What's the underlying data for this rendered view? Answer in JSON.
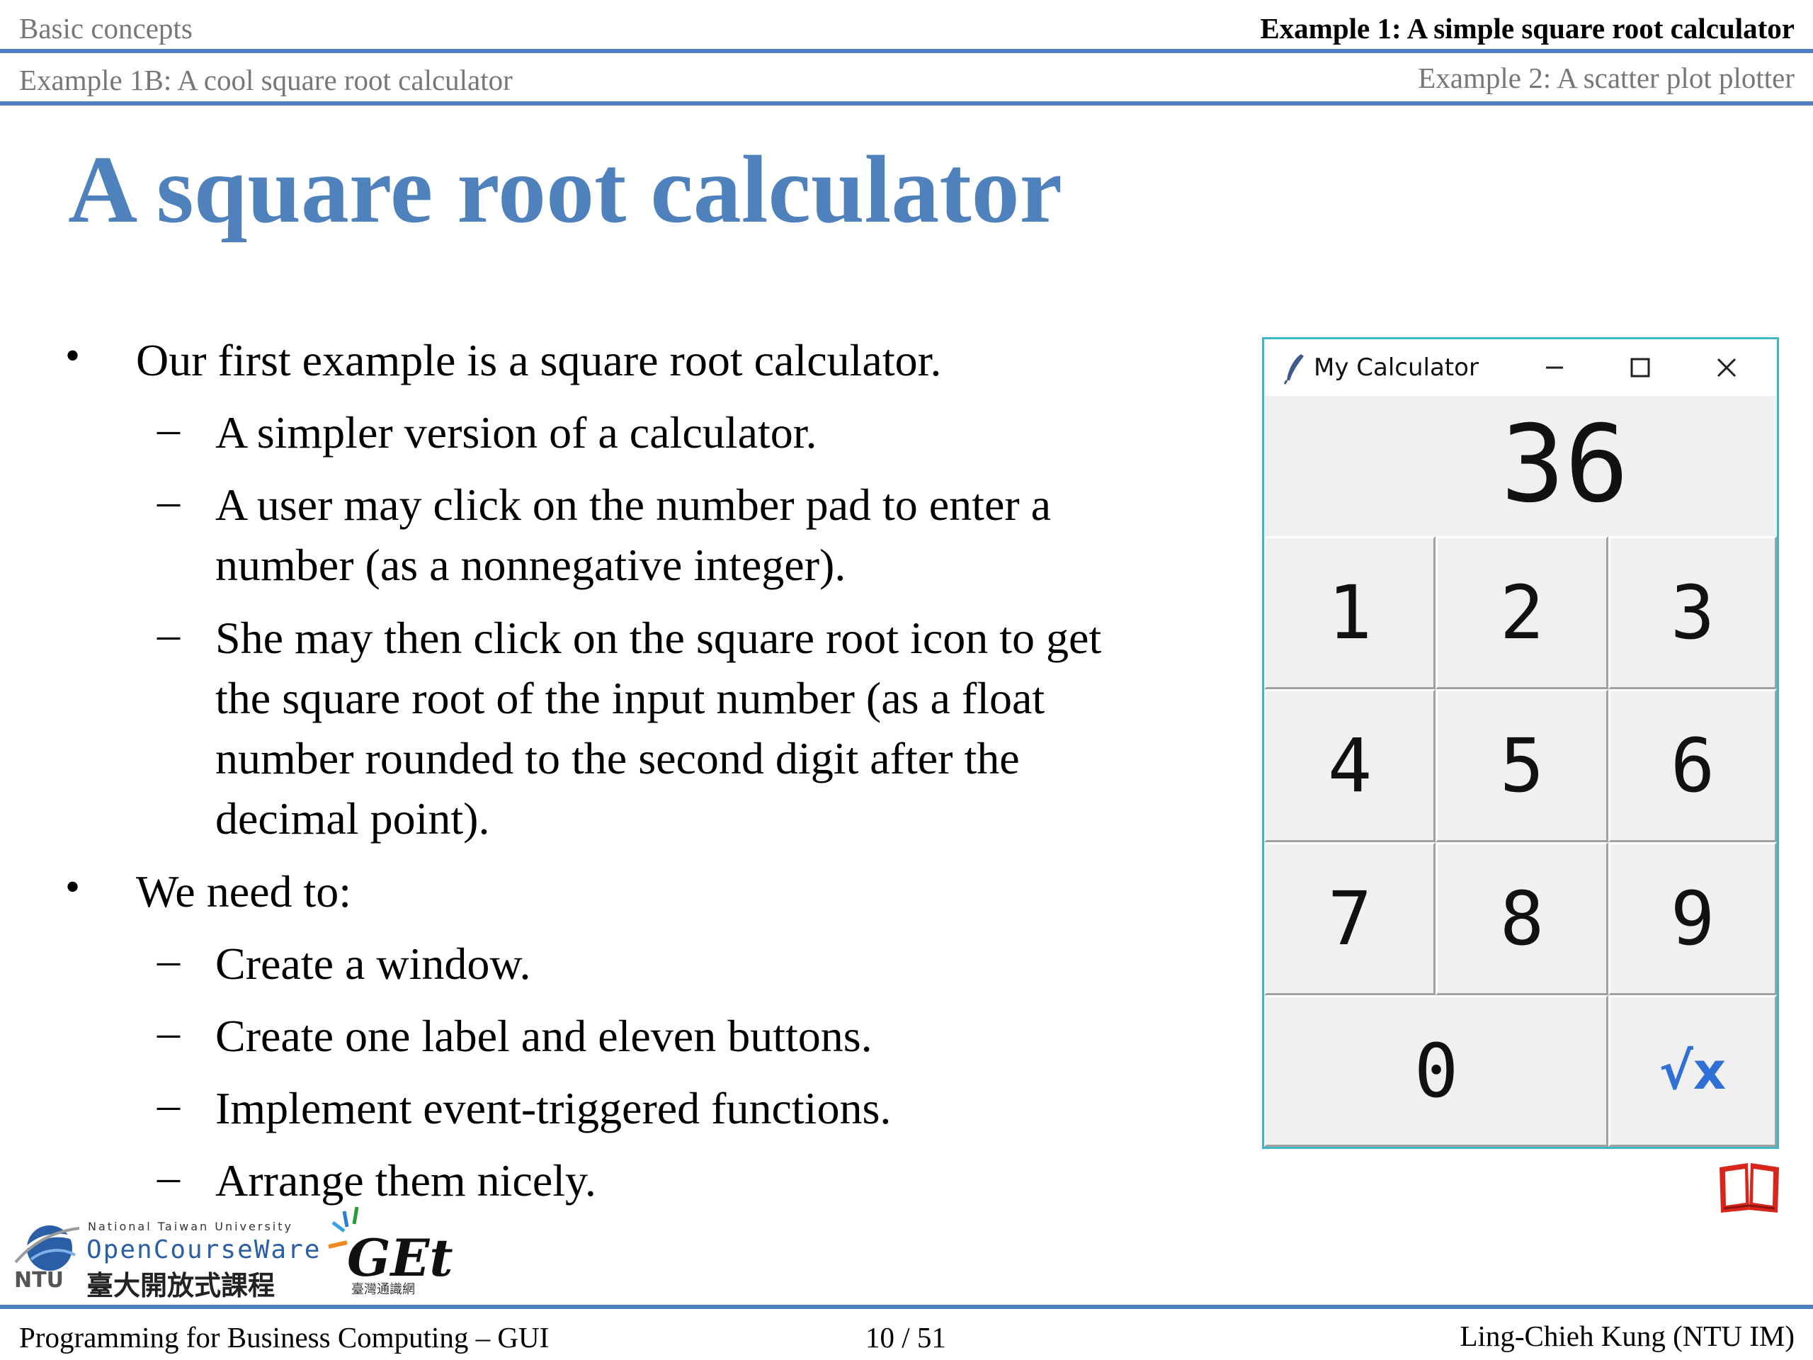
{
  "header": {
    "section_left": "Basic concepts",
    "section_right": "Example 1: A simple square root calculator",
    "sub_left": "Example 1B: A cool square root calculator",
    "sub_right": "Example 2: A scatter plot plotter"
  },
  "slide": {
    "title": "A square root calculator",
    "bullets": [
      "Our first example is a square root calculator.",
      "A simpler version of a calculator.",
      "A user may click on the number pad to enter a",
      "number (as a nonnegative integer).",
      "She may then click on the square root icon to get",
      "the square root of the input number (as a float",
      "number rounded to the second digit after the",
      "decimal point).",
      "We need to:",
      "Create a window.",
      "Create one label and eleven buttons.",
      "Implement event-triggered functions.",
      "Arrange them nicely."
    ],
    "bullet_marker": "•",
    "dash_marker": "–"
  },
  "calculator": {
    "window_title": "My Calculator",
    "display_value": "36",
    "keys": [
      "1",
      "2",
      "3",
      "4",
      "5",
      "6",
      "7",
      "8",
      "9",
      "0",
      "√x"
    ],
    "accent_color": "#2f6fd6",
    "border_color": "#3fb7c3"
  },
  "logos": {
    "ocw_line1": "National Taiwan University",
    "ocw_line2": "OpenCourseWare",
    "ocw_line3": "臺大開放式課程",
    "ntu_mark": "NTU",
    "get_mark": "GEt",
    "get_sub": "臺灣通識網"
  },
  "footer": {
    "course": "Programming for Business Computing – GUI",
    "page": "10 / 51",
    "author": "Ling-Chieh Kung (NTU IM)"
  },
  "colors": {
    "title_blue": "#4f81bd",
    "rule_blue": "#4f7fc0",
    "book_red": "#d9261c"
  }
}
